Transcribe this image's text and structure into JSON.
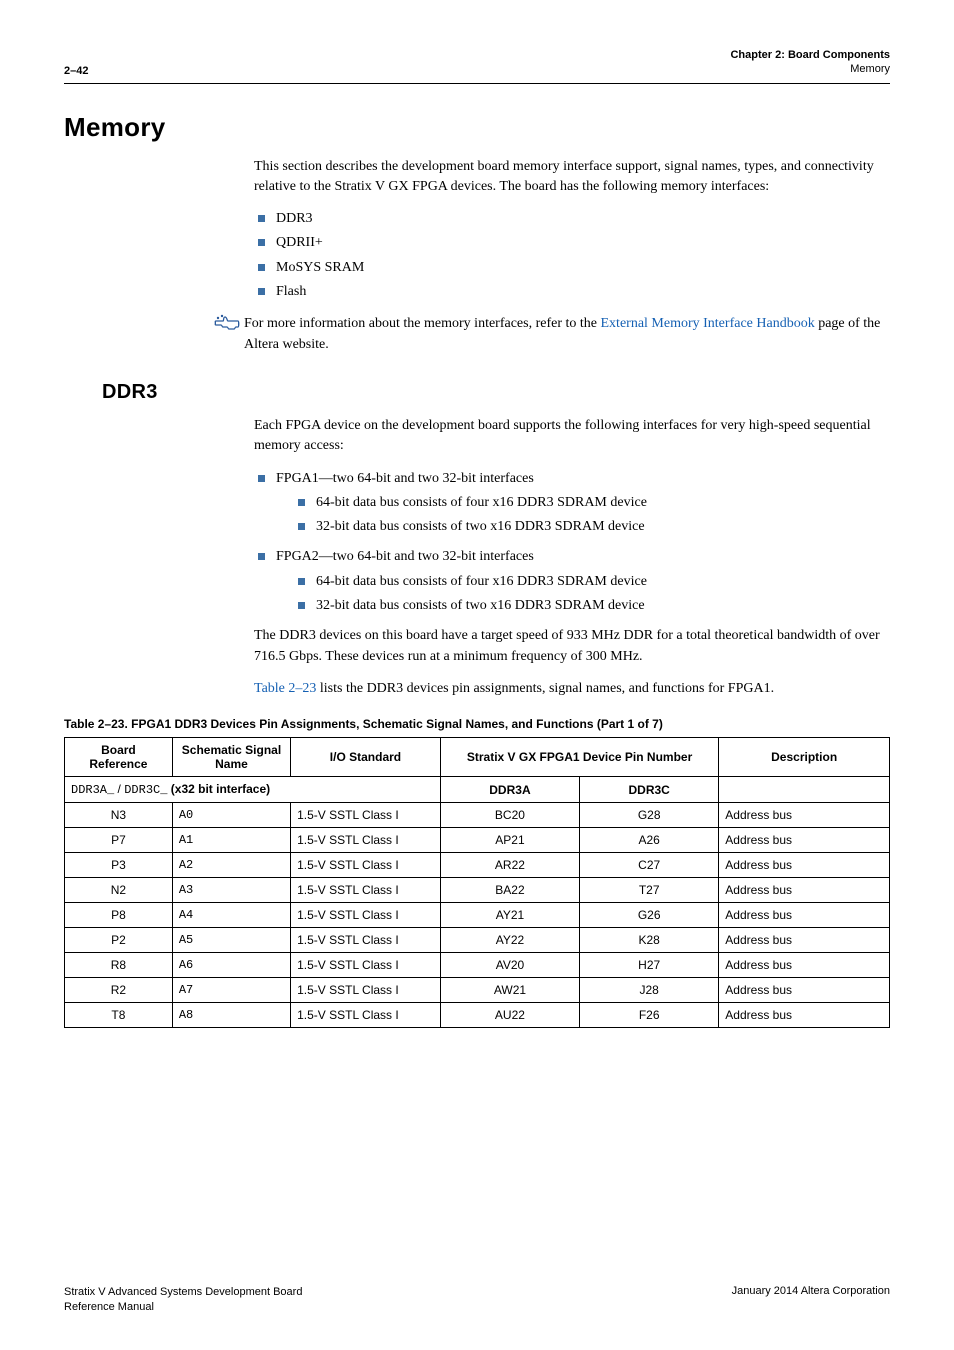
{
  "header": {
    "page_num": "2–42",
    "chapter": "Chapter 2: Board Components",
    "section": "Memory"
  },
  "h_memory": "Memory",
  "mem_intro": "This section describes the development board memory interface support, signal names, types, and connectivity relative to the Stratix V GX FPGA devices. The board has the following memory interfaces:",
  "mem_items": {
    "a": "DDR3",
    "b": "QDRII+",
    "c": "MoSYS SRAM",
    "d": "Flash"
  },
  "info_prefix": "For more information about the memory interfaces, refer to the ",
  "info_link": "External Memory Interface Handbook",
  "info_suffix": " page of the Altera website.",
  "h_ddr3": "DDR3",
  "ddr3_intro": "Each FPGA device on the development board supports the following interfaces for very high-speed sequential memory access:",
  "ddr3_l1a": "FPGA1—two 64-bit and two 32-bit interfaces",
  "ddr3_l1a_s1": "64-bit data bus consists of four x16 DDR3 SDRAM device",
  "ddr3_l1a_s2": "32-bit data bus consists of two x16 DDR3 SDRAM device",
  "ddr3_l1b": "FPGA2—two 64-bit and two 32-bit interfaces",
  "ddr3_l1b_s1": "64-bit data bus consists of four x16 DDR3 SDRAM device",
  "ddr3_l1b_s2": "32-bit data bus consists of two x16 DDR3 SDRAM device",
  "ddr3_para2": "The DDR3 devices on this board have a target speed of 933 MHz DDR for a total theoretical bandwidth of over 716.5 Gbps. These devices run at a minimum frequency of 300 MHz.",
  "ddr3_para3_pre": "",
  "ddr3_para3_link": "Table 2–23",
  "ddr3_para3_post": " lists the DDR3 devices pin assignments, signal names, and functions for FPGA1.",
  "table_caption": "Table 2–23.  FPGA1 DDR3 Devices Pin Assignments, Schematic Signal Names, and Functions  (Part 1 of 7)",
  "th": {
    "c1": "Board Reference",
    "c2": "Schematic Signal Name",
    "c3": "I/O Standard",
    "c4": "Stratix V GX FPGA1 Device Pin Number",
    "c5": "Description",
    "sub_a": "DDR3A",
    "sub_c": "DDR3C"
  },
  "subhead_prefix": "DDR3A_",
  "subhead_mid": " / ",
  "subhead_prefix2": "DDR3C_",
  "subhead_rest": " (x32 bit interface)",
  "rows": [
    {
      "br": "N3",
      "sn": "A0",
      "io": "1.5-V SSTL Class I",
      "a": "BC20",
      "c": "G28",
      "d": "Address bus"
    },
    {
      "br": "P7",
      "sn": "A1",
      "io": "1.5-V SSTL Class I",
      "a": "AP21",
      "c": "A26",
      "d": "Address bus"
    },
    {
      "br": "P3",
      "sn": "A2",
      "io": "1.5-V SSTL Class I",
      "a": "AR22",
      "c": "C27",
      "d": "Address bus"
    },
    {
      "br": "N2",
      "sn": "A3",
      "io": "1.5-V SSTL Class I",
      "a": "BA22",
      "c": "T27",
      "d": "Address bus"
    },
    {
      "br": "P8",
      "sn": "A4",
      "io": "1.5-V SSTL Class I",
      "a": "AY21",
      "c": "G26",
      "d": "Address bus"
    },
    {
      "br": "P2",
      "sn": "A5",
      "io": "1.5-V SSTL Class I",
      "a": "AY22",
      "c": "K28",
      "d": "Address bus"
    },
    {
      "br": "R8",
      "sn": "A6",
      "io": "1.5-V SSTL Class I",
      "a": "AV20",
      "c": "H27",
      "d": "Address bus"
    },
    {
      "br": "R2",
      "sn": "A7",
      "io": "1.5-V SSTL Class I",
      "a": "AW21",
      "c": "J28",
      "d": "Address bus"
    },
    {
      "br": "T8",
      "sn": "A8",
      "io": "1.5-V SSTL Class I",
      "a": "AU22",
      "c": "F26",
      "d": "Address bus"
    }
  ],
  "footer": {
    "left1": "Stratix V Advanced Systems Development Board",
    "left2": "Reference Manual",
    "right": "January 2014   Altera Corporation"
  }
}
